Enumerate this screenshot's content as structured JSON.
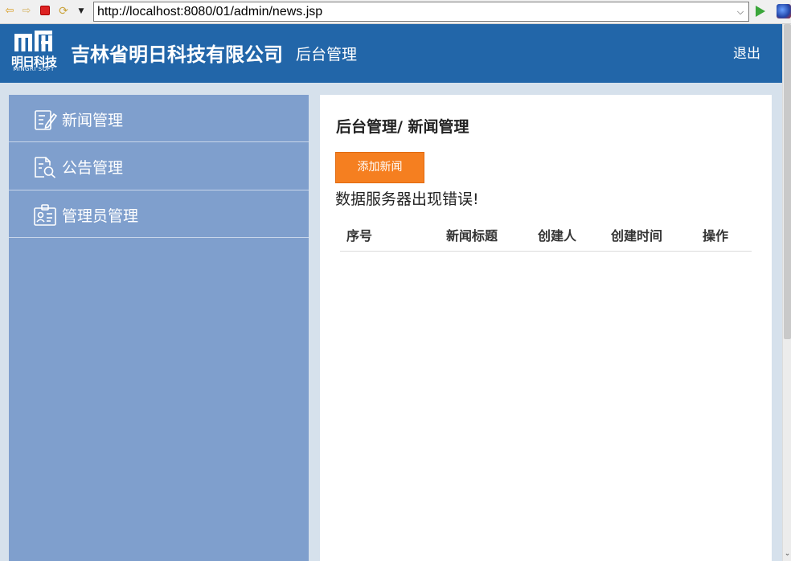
{
  "browser": {
    "url": "http://localhost:8080/01/admin/news.jsp",
    "dropdown_glyph": "⌵",
    "back_glyph": "⇦",
    "forward_glyph": "⇨",
    "refresh_glyph": "⟳",
    "menu_glyph": "▼"
  },
  "header": {
    "logo_cn": "明日科技",
    "logo_en": "MINGRI SOFT",
    "company_name": "吉林省明日科技有限公司",
    "subtitle": "后台管理",
    "logout": "退出"
  },
  "sidebar": {
    "items": [
      {
        "label": "新闻管理",
        "icon": "news-edit-icon"
      },
      {
        "label": "公告管理",
        "icon": "notice-search-icon"
      },
      {
        "label": "管理员管理",
        "icon": "admin-badge-icon"
      }
    ]
  },
  "main": {
    "breadcrumb": "后台管理/ 新闻管理",
    "add_button": "添加新闻",
    "error_message": "数据服务器出现错误!",
    "table": {
      "headers": [
        "序号",
        "新闻标题",
        "创建人",
        "创建时间",
        "操作"
      ]
    }
  },
  "colors": {
    "header_bg": "#2266a9",
    "sidebar_bg": "#7f9fcd",
    "accent_button": "#f57f20",
    "page_bg": "#d6e1ec"
  }
}
